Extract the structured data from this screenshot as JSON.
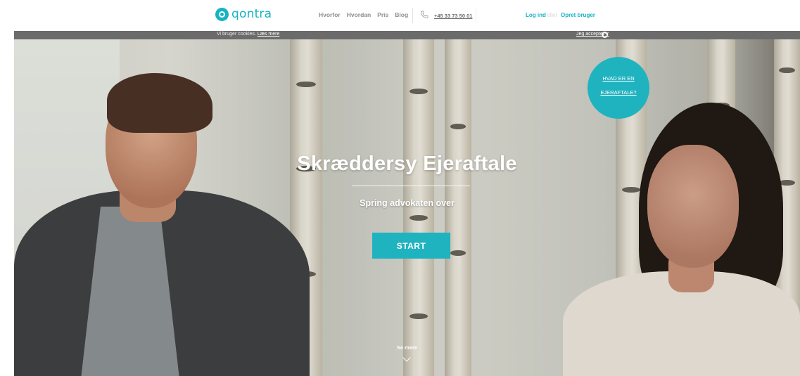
{
  "brand": {
    "name": "qontra",
    "color": "#17b3c1"
  },
  "nav": {
    "items": [
      {
        "label": "Hvorfor"
      },
      {
        "label": "Hvordan"
      },
      {
        "label": "Pris"
      },
      {
        "label": "Blog"
      }
    ],
    "phone_icon": "phone-icon",
    "phone": "+45 33 73 50 01"
  },
  "account": {
    "login": "Log ind",
    "or": "eller",
    "signup": "Opret bruger"
  },
  "cookie": {
    "text": "Vi bruger cookies.",
    "more": "Læs mere",
    "accept": "Jeg accepterer",
    "close_icon": "close-icon"
  },
  "hero": {
    "title": "Skræddersy Ejeraftale",
    "subtitle": "Spring advokaten over",
    "cta": "START",
    "badge_line1": "HVAD ER EN",
    "badge_line2": "EJERAFTALE?",
    "see_more": "Se mere",
    "scroll_icon": "chevron-down-icon"
  },
  "colors": {
    "accent": "#1fb3c0",
    "cookiebar": "#6b6b6b",
    "nav_text": "#8e8e8e"
  }
}
